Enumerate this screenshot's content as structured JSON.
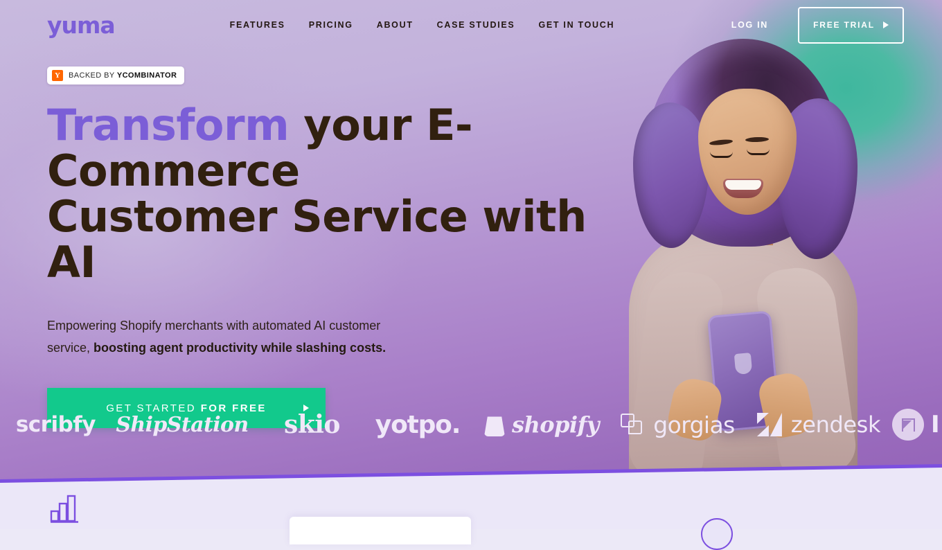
{
  "brand": {
    "logo_text": "yuma",
    "logo_color": "#7b5ed7"
  },
  "nav": {
    "links": [
      {
        "label": "FEATURES",
        "name": "features"
      },
      {
        "label": "PRICING",
        "name": "pricing"
      },
      {
        "label": "ABOUT",
        "name": "about"
      },
      {
        "label": "CASE STUDIES",
        "name": "case-studies"
      },
      {
        "label": "GET IN TOUCH",
        "name": "get-in-touch"
      }
    ],
    "login_label": "LOG IN",
    "trial_label": "FREE TRIAL"
  },
  "hero": {
    "badge": {
      "mark": "Y",
      "prefix": "BACKED BY ",
      "brand": "YCOMBINATOR"
    },
    "headline": {
      "accent": "Transform",
      "rest_line1": " your E-Commerce",
      "line2": "Customer Service with  AI"
    },
    "subheading": {
      "plain1": "Empowering Shopify merchants with automated AI customer service, ",
      "bold": "boosting agent productivity while slashing costs."
    },
    "cta": {
      "label": "GET STARTED",
      "label_bold": "FOR FREE"
    }
  },
  "marquee": {
    "logos": [
      {
        "name": "scribfy",
        "text": "scribfy"
      },
      {
        "name": "shipstation",
        "text": "ShipStation"
      },
      {
        "name": "skio",
        "text": "skio"
      },
      {
        "name": "yotpo",
        "text": "yotpo."
      },
      {
        "name": "shopify",
        "text": "shopify"
      },
      {
        "name": "gorgias",
        "text": "gorgias"
      },
      {
        "name": "zendesk",
        "text": "zendesk"
      },
      {
        "name": "next-partial",
        "text": ""
      }
    ]
  },
  "colors": {
    "accent_purple": "#7b5ed7",
    "cta_green": "#12c98c",
    "teal_glow": "#4cbaa3",
    "hero_purple_top": "#c8bade",
    "hero_purple_bottom": "#9463b8",
    "divider_purple": "#7c4fe0",
    "lower_bg": "#ebe7f8",
    "yc_orange": "#ff6600",
    "headline_dark": "#31200f"
  }
}
